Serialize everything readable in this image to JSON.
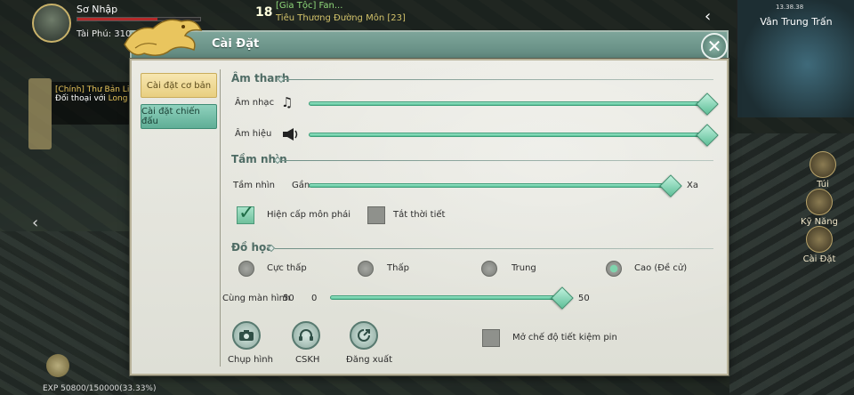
{
  "hud": {
    "player_name": "Sơ Nhập",
    "wealth": "Tài Phú: 310",
    "level_display": "18",
    "chat_line1": "[Gia Tộc]  Fan...",
    "chat_line2": "Tiêu Thương Đường Môn  [23]",
    "quest_title": "[Chính] Thư Bản Linh",
    "quest_desc_prefix": "Đối thoại với ",
    "quest_desc_target": "Long Ng",
    "exp": "EXP 50800/150000(33.33%)",
    "minimap_title": "Vân Trung Trấn",
    "minimap_time": "13.38.38",
    "side_buttons": [
      "Túi",
      "Kỹ Năng",
      "Cài Đặt"
    ]
  },
  "dialog": {
    "title": "Cài Đặt",
    "close_symbol": "✕",
    "tabs": [
      {
        "label": "Cài đặt cơ bản",
        "active": true
      },
      {
        "label": "Cài đặt chiến đấu",
        "active": false
      }
    ],
    "sound": {
      "section_title": "Âm thanh",
      "music_label": "Âm nhạc",
      "music_value": 1.0,
      "effects_label": "Âm hiệu",
      "effects_value": 1.0
    },
    "view": {
      "section_title": "Tầm nhìn",
      "label": "Tầm nhìn",
      "min_label": "Gần",
      "max_label": "Xa",
      "value": 0.94,
      "show_sect_level_label": "Hiện cấp môn phái",
      "show_sect_level_checked": true,
      "weather_off_label": "Tắt thời tiết",
      "weather_off_checked": false
    },
    "graphics": {
      "section_title": "Đồ họa",
      "options": [
        {
          "label": "Cực thấp",
          "selected": false
        },
        {
          "label": "Thấp",
          "selected": false
        },
        {
          "label": "Trung",
          "selected": false
        },
        {
          "label": "Cao (Đề cử)",
          "selected": true
        }
      ],
      "same_screen_label": "Cùng màn hình",
      "same_screen_value_label": "50",
      "same_screen_min": "0",
      "same_screen_max": "50",
      "same_screen_value": 1.0
    },
    "bottom": {
      "screenshot_label": "Chụp hình",
      "support_label": "CSKH",
      "logout_label": "Đăng xuất",
      "power_save_label": "Mở chế độ tiết kiệm pin",
      "power_save_checked": false
    }
  },
  "colors": {
    "accent_green": "#5fbf98",
    "header_teal": "#6f958a",
    "tab_active_gold": "#e8cf80"
  }
}
